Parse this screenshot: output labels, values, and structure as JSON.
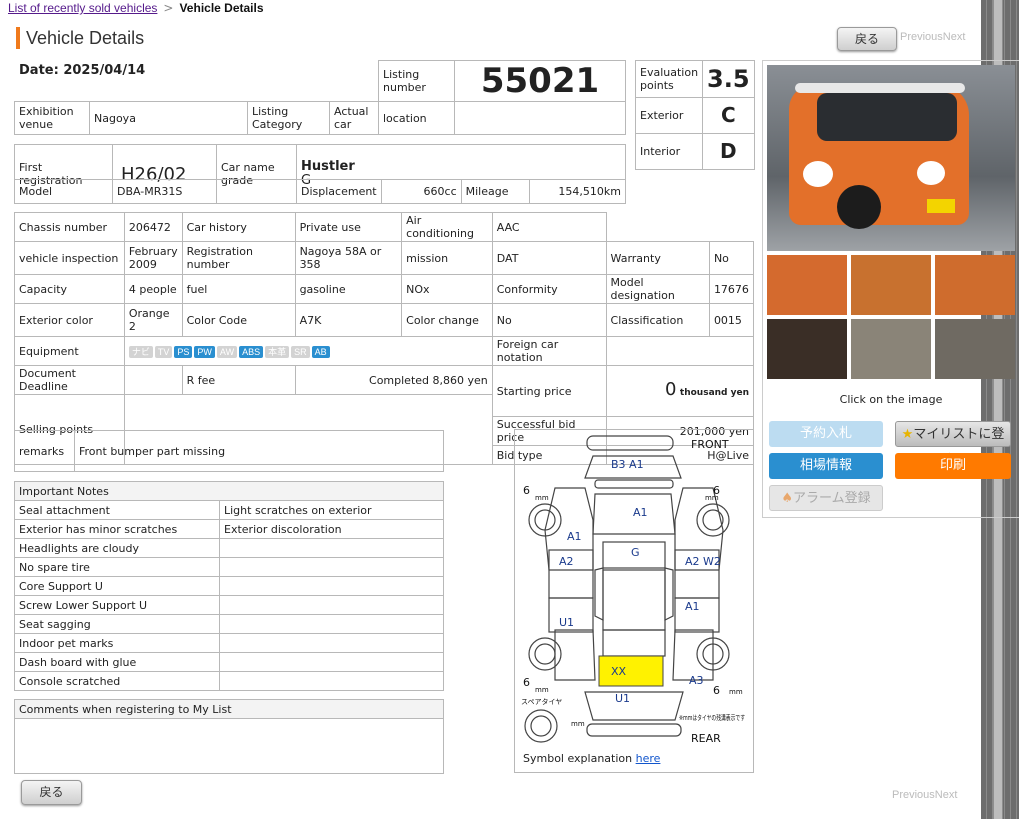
{
  "breadcrumb": {
    "link": "List of recently sold vehicles",
    "sep": ">",
    "current": "Vehicle Details"
  },
  "page_title": "Vehicle Details",
  "nav": {
    "back": "戻る",
    "previous": "Previous",
    "next": "Next"
  },
  "date": "Date: 2025/04/14",
  "listing": {
    "label": "Listing number",
    "value": "55021"
  },
  "evaluation": {
    "label": "Evaluation points",
    "value": "3.5",
    "exterior_label": "Exterior",
    "exterior_value": "C",
    "interior_label": "Interior",
    "interior_value": "D"
  },
  "venue": {
    "label": "Exhibition venue",
    "value": "Nagoya",
    "category_label": "Listing Category",
    "actual_car_label": "Actual car",
    "location_label": "location"
  },
  "reg": {
    "first_label": "First registration",
    "first_value": "H26/02",
    "car_name_label": "Car name grade",
    "car_name": "Hustler",
    "grade": "G",
    "model_label": "Model",
    "model_value": "DBA-MR31S",
    "disp_label": "Displacement",
    "disp_value": "660cc",
    "mileage_label": "Mileage",
    "mileage_value": "154,510km"
  },
  "specs": {
    "chassis_label": "Chassis number",
    "chassis": "206472",
    "history_label": "Car history",
    "private": "Private use",
    "ac_label": "Air conditioning",
    "ac": "AAC",
    "inspection_label": "vehicle inspection",
    "inspection": "February 2009",
    "regno_label": "Registration number",
    "regno": "Nagoya 58A or 358",
    "mission_label": "mission",
    "mission": "DAT",
    "warranty_label": "Warranty",
    "warranty": "No",
    "capacity_label": "Capacity",
    "capacity": "4 people",
    "fuel_label": "fuel",
    "fuel": "gasoline",
    "nox_label": "NOx",
    "conform_label": "Conformity",
    "designation_label": "Model designation",
    "designation": "17676",
    "color_label": "Exterior color",
    "color": "Orange 2",
    "colorcode_label": "Color Code",
    "colorcode": "A7K",
    "colorchange_label": "Color change",
    "colorchange": "No",
    "class_label": "Classification",
    "class": "0015",
    "equipment_label": "Equipment",
    "foreign_label": "Foreign car notation",
    "doc_label": "Document Deadline",
    "rfee_label": "R fee",
    "rfee": "Completed 8,860 yen",
    "start_label": "Starting price",
    "start_value": "0",
    "start_unit": "thousand yen",
    "selling_label": "Selling points",
    "bid_label": "Successful bid price",
    "bid": "201,000 yen",
    "bidtype_label": "Bid type",
    "bidtype": "H@Live"
  },
  "equipment": [
    {
      "t": "ナビ",
      "on": false
    },
    {
      "t": "TV",
      "on": false
    },
    {
      "t": "PS",
      "on": true
    },
    {
      "t": "PW",
      "on": true
    },
    {
      "t": "AW",
      "on": false
    },
    {
      "t": "ABS",
      "on": true
    },
    {
      "t": "本革",
      "on": false
    },
    {
      "t": "SR",
      "on": false
    },
    {
      "t": "AB",
      "on": true
    }
  ],
  "remarks": {
    "label": "remarks",
    "value": "Front bumper part missing"
  },
  "notes": {
    "title": "Important Notes",
    "rows": [
      [
        "Seal attachment",
        "Light scratches on exterior"
      ],
      [
        "Exterior has minor scratches",
        "Exterior discoloration"
      ],
      [
        "Headlights are cloudy",
        ""
      ],
      [
        "No spare tire",
        ""
      ],
      [
        "Core Support U",
        ""
      ],
      [
        "Screw Lower Support U",
        ""
      ],
      [
        "Seat sagging",
        ""
      ],
      [
        "Indoor pet marks",
        ""
      ],
      [
        "Dash board with glue",
        ""
      ],
      [
        "Console scratched",
        ""
      ]
    ]
  },
  "comments": {
    "label": "Comments when registering to My List"
  },
  "diagram": {
    "front": "FRONT",
    "rear": "REAR",
    "b3a1": "B3 A1",
    "a1_hood": "A1",
    "a1_left": "A1",
    "a2_left": "A2",
    "u1_left": "U1",
    "g": "G",
    "a2w2": "A2 W2",
    "a1_right": "A1",
    "a3": "A3",
    "xx": "XX",
    "u1_rear": "U1",
    "six": "6",
    "mm": "mm",
    "spare": "スペアタイヤ",
    "note": "※mmはタイヤの残溝表示です",
    "symbol_text": "Symbol explanation",
    "symbol_link": "here"
  },
  "image_panel": {
    "click": "Click on the image"
  },
  "actions": {
    "reserve": "予約入札",
    "mylist": "マイリストに登録",
    "market": "相場情報",
    "print": "印刷",
    "alarm": "アラーム登録"
  },
  "colors": {
    "accent": "#f07a1c",
    "blue": "#2a8fd0",
    "print": "#ff7a00",
    "highlight": "#fff200"
  }
}
